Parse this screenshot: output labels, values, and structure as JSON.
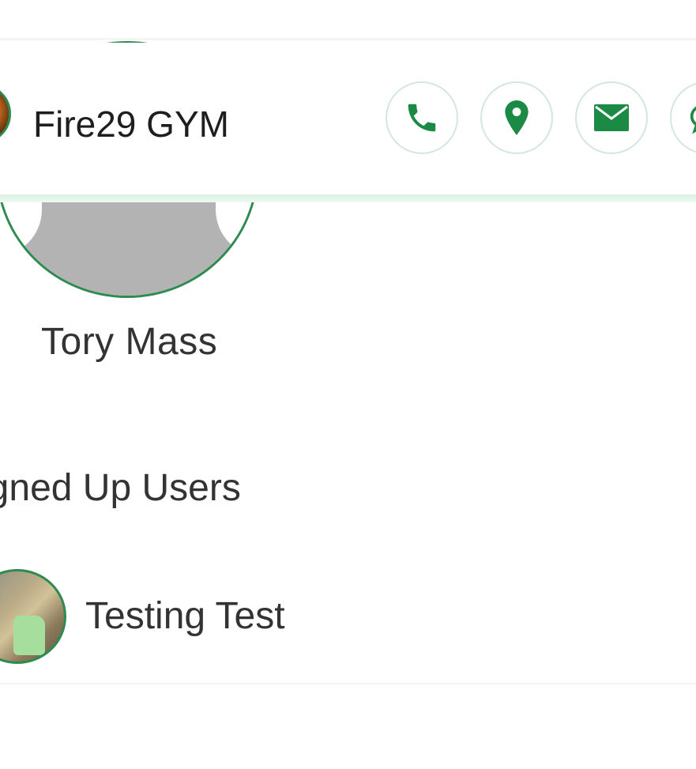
{
  "header": {
    "gym_name": "Fire29 GYM",
    "actions": [
      {
        "name": "phone",
        "icon": "phone-icon"
      },
      {
        "name": "location",
        "icon": "map-pin-icon"
      },
      {
        "name": "email",
        "icon": "mail-icon"
      },
      {
        "name": "chat",
        "icon": "chat-bubble-icon"
      }
    ]
  },
  "trainer": {
    "name": "Tory Mass",
    "avatar_icon": "default-user-silhouette"
  },
  "signed_up_users": {
    "title": "Signed Up Users",
    "users": [
      {
        "name": "Testing Test"
      }
    ]
  },
  "colors": {
    "accent": "#1a8a45",
    "avatar_border": "#2e8b50",
    "text": "#333333"
  }
}
